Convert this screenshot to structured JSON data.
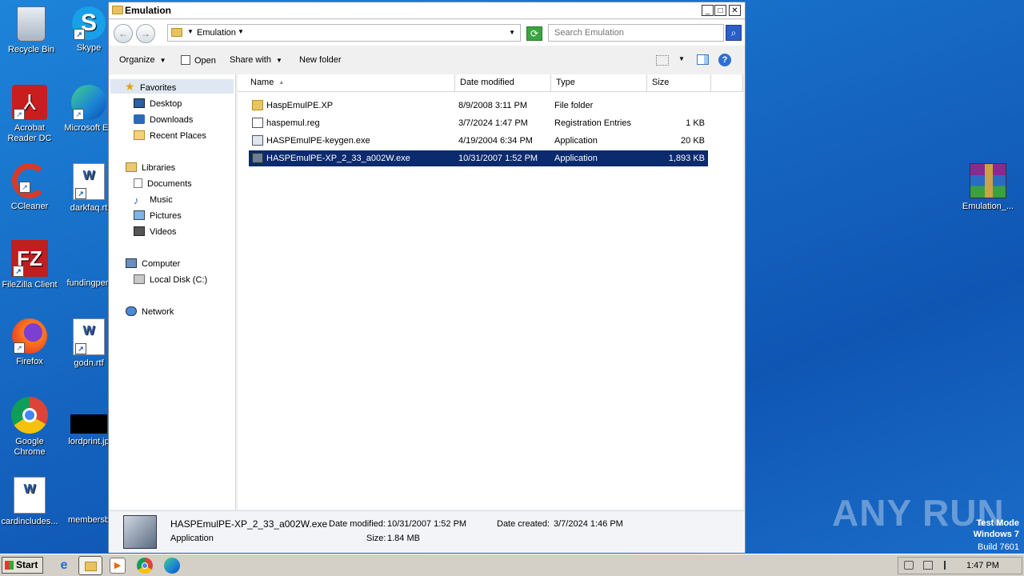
{
  "desktop": {
    "icons_left": [
      {
        "label": "Recycle Bin",
        "icon": "recycle-bin-icon"
      },
      {
        "label": "Skype",
        "icon": "skype-icon"
      },
      {
        "label": "Acrobat Reader DC",
        "icon": "acrobat-icon"
      },
      {
        "label": "Microsoft Ed",
        "icon": "edge-icon"
      },
      {
        "label": "CCleaner",
        "icon": "ccleaner-icon"
      },
      {
        "label": "darkfaq.rt",
        "icon": "word-doc-icon"
      },
      {
        "label": "FileZilla Client",
        "icon": "filezilla-icon"
      },
      {
        "label": "fundingperf",
        "icon": "word-doc-icon"
      },
      {
        "label": "Firefox",
        "icon": "firefox-icon"
      },
      {
        "label": "godn.rtf",
        "icon": "word-doc-icon"
      },
      {
        "label": "Google Chrome",
        "icon": "chrome-icon"
      },
      {
        "label": "lordprint.jp",
        "icon": "image-file-icon"
      },
      {
        "label": "cardincludes...",
        "icon": "word-doc-icon"
      },
      {
        "label": "membersb",
        "icon": "file-icon"
      }
    ],
    "right_icon_label": "Emulation_...",
    "watermark": "ANY RUN",
    "test_mode": {
      "line1": "Test Mode",
      "line2": "Windows 7",
      "line3": "Build 7601"
    }
  },
  "window": {
    "title": "Emulation",
    "address_crumb": "Emulation",
    "search_placeholder": "Search Emulation",
    "toolbar": {
      "organize": "Organize",
      "open": "Open",
      "share_with": "Share with",
      "new_folder": "New folder"
    },
    "nav": {
      "favorites": "Favorites",
      "desktop": "Desktop",
      "downloads": "Downloads",
      "recent_places": "Recent Places",
      "libraries": "Libraries",
      "documents": "Documents",
      "music": "Music",
      "pictures": "Pictures",
      "videos": "Videos",
      "computer": "Computer",
      "local_disk": "Local Disk (C:)",
      "network": "Network"
    },
    "columns": {
      "name": "Name",
      "date_modified": "Date modified",
      "type": "Type",
      "size": "Size"
    },
    "files": [
      {
        "name": "HaspEmulPE.XP",
        "date": "8/9/2008 3:11 PM",
        "type": "File folder",
        "size": "",
        "icon": "folder-icon"
      },
      {
        "name": "haspemul.reg",
        "date": "3/7/2024 1:47 PM",
        "type": "Registration Entries",
        "size": "1 KB",
        "icon": "registry-file-icon"
      },
      {
        "name": "HASPEmulPE-keygen.exe",
        "date": "4/19/2004 6:34 PM",
        "type": "Application",
        "size": "20 KB",
        "icon": "exe-icon"
      },
      {
        "name": "HASPEmulPE-XP_2_33_a002W.exe",
        "date": "10/31/2007 1:52 PM",
        "type": "Application",
        "size": "1,893 KB",
        "icon": "setup-exe-icon"
      }
    ],
    "details": {
      "filename": "HASPEmulPE-XP_2_33_a002W.exe",
      "filetype": "Application",
      "date_modified_label": "Date modified:",
      "date_modified": "10/31/2007 1:52 PM",
      "size_label": "Size:",
      "size": "1.84 MB",
      "date_created_label": "Date created:",
      "date_created": "3/7/2024 1:46 PM"
    }
  },
  "taskbar": {
    "start": "Start",
    "clock": "1:47 PM"
  }
}
